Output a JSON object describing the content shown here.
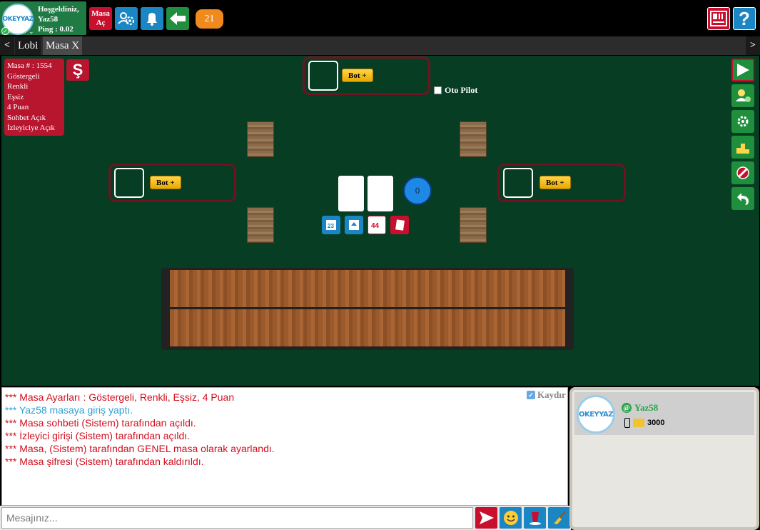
{
  "header": {
    "logo_text": "OKEYYAZ",
    "welcome_line": "Hoşgeldiniz,",
    "username": "Yaz58",
    "ping": "Ping : 0.02",
    "masa_ac_line1": "Masa",
    "masa_ac_line2": "Aç",
    "count_badge": "21"
  },
  "tabs": {
    "prev": "<",
    "next": ">",
    "items": [
      "Lobi",
      "Masa X"
    ]
  },
  "table_info": {
    "lines": [
      "Masa # : 1554",
      "Göstergeli",
      "Renkli",
      "Eşsiz",
      "4 Puan",
      "Sohbet Açık",
      "İzleyiciye Açık"
    ],
    "s_button": "Ş"
  },
  "seats": {
    "bot_label": "Bot +"
  },
  "oto_pilot": "Oto Pilot",
  "center": {
    "counter": "0"
  },
  "chat": {
    "kaydir_label": "Kaydır",
    "messages": [
      {
        "text": "*** Masa Ayarları : Göstergeli, Renkli, Eşsiz, 4 Puan",
        "color": "red"
      },
      {
        "text": "*** Yaz58 masaya giriş yaptı.",
        "color": "blue"
      },
      {
        "text": "*** Masa sohbeti (Sistem) tarafından açıldı.",
        "color": "red"
      },
      {
        "text": "*** İzleyici girişi (Sistem) tarafından açıldı.",
        "color": "red"
      },
      {
        "text": "*** Masa, (Sistem) tarafından GENEL masa olarak ayarlandı.",
        "color": "red"
      },
      {
        "text": "*** Masa şifresi (Sistem) tarafından kaldırıldı.",
        "color": "red"
      }
    ],
    "placeholder": "Mesajınız..."
  },
  "users": {
    "list": [
      {
        "name": "Yaz58",
        "coins": "3000",
        "avatar_text": "OKEYYAZ"
      }
    ]
  },
  "colors": {
    "table_felt": "#073d23",
    "accent_red": "#c8102e",
    "accent_blue": "#1a86c4",
    "accent_green": "#1f8f3e",
    "badge_orange": "#f08a1e"
  }
}
